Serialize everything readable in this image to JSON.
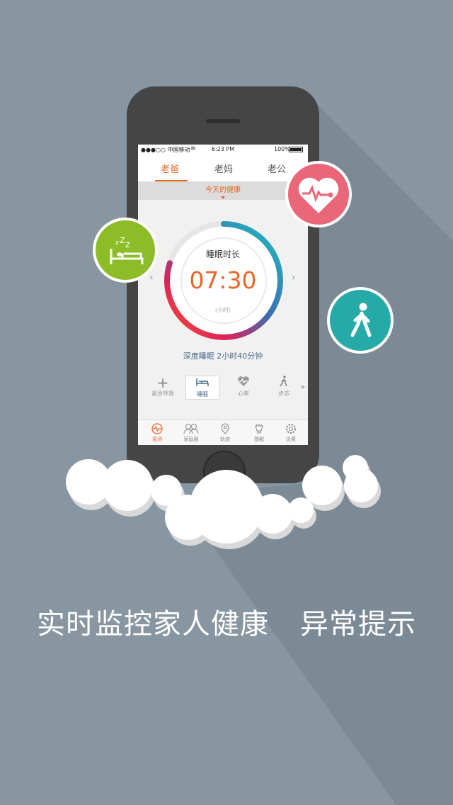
{
  "status_bar": {
    "carrier": "●●●○○ 中国移动",
    "time": "6:23 PM",
    "battery": "100%"
  },
  "tabs": [
    {
      "label": "老爸",
      "active": true
    },
    {
      "label": "老妈",
      "active": false
    },
    {
      "label": "老公",
      "active": false
    }
  ],
  "today_label": "今天的健康",
  "sleep": {
    "title": "睡眠时长",
    "value": "07:30",
    "unit": "(小时)",
    "deep_sleep": "深度睡眠 2小时40分钟",
    "progress_fraction": 0.8
  },
  "functions": [
    {
      "label": "紧急呼救",
      "icon": "plus-icon"
    },
    {
      "label": "睡眠",
      "icon": "bed-icon",
      "selected": true
    },
    {
      "label": "心率",
      "icon": "heart-rate-icon"
    },
    {
      "label": "步态",
      "icon": "walk-icon"
    }
  ],
  "bottom_nav": [
    {
      "label": "监测",
      "icon": "monitor-icon",
      "active": true
    },
    {
      "label": "家庭圈",
      "icon": "family-icon"
    },
    {
      "label": "轨迹",
      "icon": "location-icon"
    },
    {
      "label": "提醒",
      "icon": "bell-icon"
    },
    {
      "label": "设置",
      "icon": "gear-icon"
    }
  ],
  "bubbles": [
    {
      "icon": "sleep-bed-icon",
      "color": "#8cbd28"
    },
    {
      "icon": "heartbeat-icon",
      "color": "#ea6679"
    },
    {
      "icon": "walking-person-icon",
      "color": "#26aaa7"
    }
  ],
  "slogan": {
    "left": "实时监控家人健康",
    "right": "异常提示"
  },
  "colors": {
    "background": "#8896a1",
    "accent": "#e8672a",
    "sleep_green": "#8cbd28",
    "heart_red": "#ea6679",
    "walk_teal": "#26aaa7"
  }
}
